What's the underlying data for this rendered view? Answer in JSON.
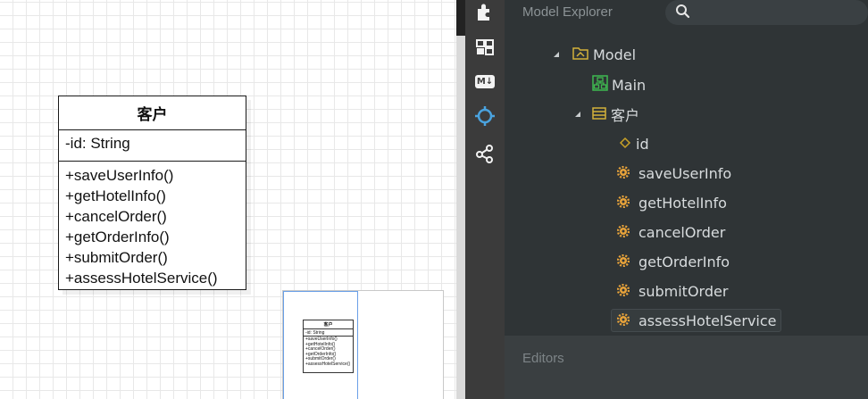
{
  "diagram": {
    "class_name": "客户",
    "attributes": [
      "-id: String"
    ],
    "operations": [
      "+saveUserInfo()",
      "+getHotelInfo()",
      "+cancelOrder()",
      "+getOrderInfo()",
      "+submitOrder()",
      "+assessHotelService()"
    ]
  },
  "minimap": {
    "class_name": "客户",
    "attribute": "-id: String",
    "operations": [
      "+saveUserInfo()",
      "+getHotelInfo()",
      "+cancelOrder()",
      "+getOrderInfo()",
      "+submitOrder()",
      "+assessHotelService()"
    ]
  },
  "toolbar": {
    "items": [
      "extensions-icon",
      "layout-icon",
      "markdown-icon",
      "target-icon",
      "share-icon"
    ],
    "markdown_label": "M↓"
  },
  "explorer": {
    "title": "Model Explorer",
    "search_placeholder": "",
    "tree": {
      "model": "Model",
      "main": "Main",
      "class": "客户",
      "attribute": "id",
      "operations": [
        "saveUserInfo",
        "getHotelInfo",
        "cancelOrder",
        "getOrderInfo",
        "submitOrder",
        "assessHotelService"
      ]
    }
  },
  "editors": {
    "title": "Editors"
  },
  "colors": {
    "sidebar_bg": "#2f3436",
    "toolbar_bg": "#3b3b3b",
    "accent_blue": "#4aa3df",
    "operation_orange": "#e8a33a",
    "attribute_yellow": "#c9a227",
    "model_gold": "#d4b13a",
    "diagram_green": "#3fb950"
  }
}
